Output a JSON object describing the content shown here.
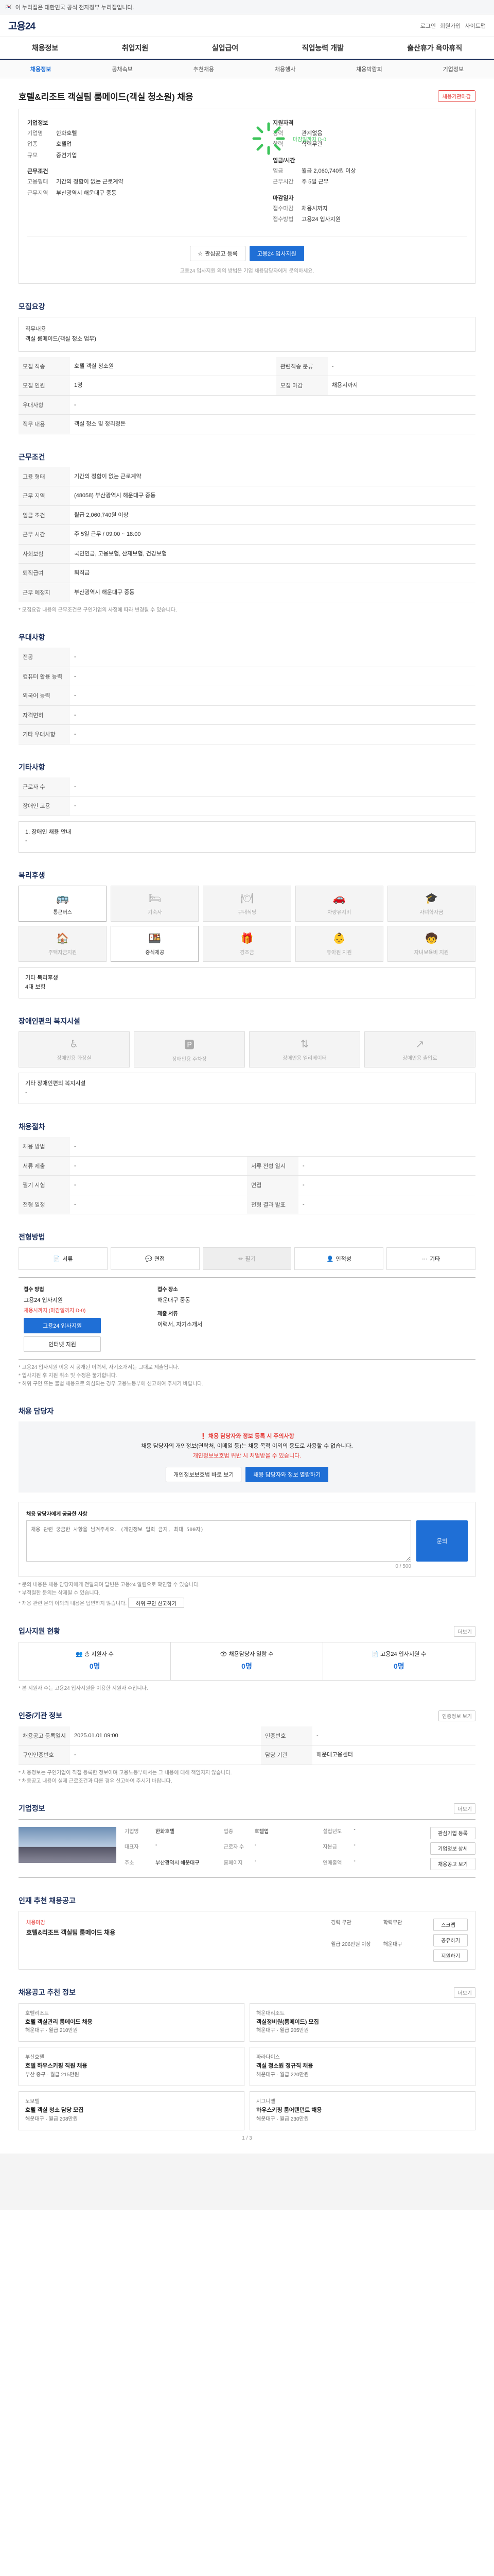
{
  "topbar": {
    "text": "이 누리집은 대한민국 공식 전자정부 누리집입니다."
  },
  "header": {
    "logo": "고용24",
    "links": [
      "로그인",
      "회원가입",
      "사이트맵"
    ]
  },
  "gnb": {
    "items": [
      "채용정보",
      "취업지원",
      "실업급여",
      "직업능력 개발",
      "출산휴가 육아휴직"
    ]
  },
  "subnav": {
    "items": [
      "채용정보",
      "공채속보",
      "추천채용",
      "채용행사",
      "채용박람회",
      "기업정보"
    ],
    "active_index": 0
  },
  "job": {
    "title": "호텔&리조트 객실팀 룸메이드(객실 청소원) 채용",
    "badge": "채용기관마감",
    "company_head": "기업정보",
    "company": [
      {
        "k": "기업명",
        "v": "한화호텔"
      },
      {
        "k": "업종",
        "v": "호텔업"
      },
      {
        "k": "규모",
        "v": "중견기업"
      }
    ],
    "cond_head": "근무조건",
    "cond": [
      {
        "k": "고용형태",
        "v": "기간의 정함이 없는 근로계약"
      },
      {
        "k": "근무지역",
        "v": "부산광역시 해운대구 중동"
      }
    ],
    "career_head": "지원자격",
    "career": [
      {
        "k": "경력",
        "v": "관계없음"
      },
      {
        "k": "학력",
        "v": "학력무관"
      }
    ],
    "wage_head": "임금/시간",
    "wage": [
      {
        "k": "임금",
        "v": "월급 2,060,740원 이상"
      },
      {
        "k": "근무시간",
        "v": "주 5일 근무"
      }
    ],
    "ring_caption": "마감일까지 D-0",
    "deadline_head": "마감일자",
    "deadline": [
      {
        "k": "접수마감",
        "v": "채용시까지"
      },
      {
        "k": "접수방법",
        "v": "고용24 입사지원"
      }
    ],
    "btn_scrap": "관심공고 등록",
    "btn_apply": "고용24 입사지원",
    "note": "고용24 입사지원 외의 방법은 기업 채용담당자에게 문의하세요."
  },
  "recruit": {
    "title": "모집요강",
    "box_h": "직무내용",
    "box_v": "객실 룸메이드(객실 청소 업무)",
    "rows": [
      {
        "k": "모집 직종",
        "v": "호텔 객실 청소원",
        "k2": "관련직종 분류",
        "v2": "-"
      },
      {
        "k": "모집 인원",
        "v": "1명",
        "k2": "모집 마감",
        "v2": "채용시까지"
      },
      {
        "k": "우대사항",
        "v": "-",
        "k2": "",
        "v2": ""
      },
      {
        "k": "직무 내용",
        "v": "객실 청소 및 정리정돈",
        "k2": "",
        "v2": ""
      }
    ]
  },
  "work": {
    "title": "근무조건",
    "rows": [
      {
        "k": "고용 형태",
        "v": "기간의 정함이 없는 근로계약"
      },
      {
        "k": "근무 지역",
        "v": "(48058) 부산광역시 해운대구 중동"
      },
      {
        "k": "임금 조건",
        "v": "월급 2,060,740원 이상"
      },
      {
        "k": "근무 시간",
        "v": "주 5일 근무 / 09:00 ~ 18:00"
      },
      {
        "k": "사회보험",
        "v": "국민연금, 고용보험, 산재보험, 건강보험"
      },
      {
        "k": "퇴직급여",
        "v": "퇴직금"
      },
      {
        "k": "근무 예정지",
        "v": "부산광역시 해운대구 중동"
      }
    ],
    "note": "* 모집요강 내용의 근무조건은 구인기업의 사정에 따라 변경될 수 있습니다."
  },
  "prefer": {
    "title": "우대사항",
    "rows": [
      {
        "k": "전공",
        "v": "-"
      },
      {
        "k": "컴퓨터 활용 능력",
        "v": "-"
      },
      {
        "k": "외국어 능력",
        "v": "-"
      },
      {
        "k": "자격면허",
        "v": "-"
      },
      {
        "k": "기타 우대사항",
        "v": "-"
      }
    ]
  },
  "etc": {
    "title": "기타사항",
    "rows": [
      {
        "k": "근로자 수",
        "v": "-"
      },
      {
        "k": "장애인 고용",
        "v": "-"
      }
    ],
    "box_h": "1. 장애인 채용 안내",
    "box_v": "-"
  },
  "welfare": {
    "title": "복리후생",
    "cards": [
      {
        "label": "통근버스",
        "icon": "bus-icon",
        "glyph": "🚌",
        "on": true
      },
      {
        "label": "기숙사",
        "icon": "bed-icon",
        "glyph": "🛏",
        "on": false
      },
      {
        "label": "구내식당",
        "icon": "meal-icon",
        "glyph": "🍽",
        "on": false
      },
      {
        "label": "차량유지비",
        "icon": "car-icon",
        "glyph": "🚗",
        "on": false
      },
      {
        "label": "자녀학자금",
        "icon": "grad-icon",
        "glyph": "🎓",
        "on": false
      },
      {
        "label": "주택자금지원",
        "icon": "house-icon",
        "glyph": "🏠",
        "on": false
      },
      {
        "label": "중식제공",
        "icon": "lunch-icon",
        "glyph": "🍱",
        "on": true
      },
      {
        "label": "경조금",
        "icon": "gift-icon",
        "glyph": "🎁",
        "on": false
      },
      {
        "label": "유아원 지원",
        "icon": "baby-icon",
        "glyph": "👶",
        "on": false
      },
      {
        "label": "자녀보육비 지원",
        "icon": "kid-icon",
        "glyph": "🧒",
        "on": false
      }
    ],
    "box_h": "기타 복리후생",
    "box_v": "4대 보험"
  },
  "disabled": {
    "title": "장애인편의 복지시설",
    "cards": [
      {
        "label": "장애인용 화장실",
        "icon": "toilet-icon",
        "glyph": "♿"
      },
      {
        "label": "장애인용 주차장",
        "icon": "parking-icon",
        "glyph": "🅿"
      },
      {
        "label": "장애인용 엘리베이터",
        "icon": "elevator-icon",
        "glyph": "⇅"
      },
      {
        "label": "장애인용 출입로",
        "icon": "ramp-icon",
        "glyph": "↗"
      }
    ],
    "box_h": "기타 장애인편의 복지시설",
    "box_v": "-"
  },
  "process": {
    "title": "채용절차",
    "rows": [
      {
        "k": "채용 방법",
        "v": "-",
        "k2": "",
        "v2": ""
      },
      {
        "k": "서류 제출",
        "v": "-",
        "k2": "서류 전형 일시",
        "v2": "-"
      },
      {
        "k": "필기 시험",
        "v": "-",
        "k2": "면접",
        "v2": "-"
      },
      {
        "k": "전형 일정",
        "v": "-",
        "k2": "전형 결과 발표",
        "v2": "-"
      }
    ]
  },
  "contact": {
    "title": "전형방법",
    "tabs": [
      {
        "label": "서류",
        "icon": "doc-icon",
        "glyph": "📄",
        "dim": false
      },
      {
        "label": "면접",
        "icon": "chat-icon",
        "glyph": "💬",
        "dim": false
      },
      {
        "label": "필기",
        "icon": "pen-icon",
        "glyph": "✏",
        "dim": true
      },
      {
        "label": "인적성",
        "icon": "person-icon",
        "glyph": "👤",
        "dim": false
      },
      {
        "label": "기타",
        "icon": "etc-icon",
        "glyph": "⋯",
        "dim": false
      }
    ],
    "h1": "접수 방법",
    "v1": "고용24 입사지원",
    "red1": "채용시까지 (마감일까지 D-0)",
    "btn1": "고용24 입사지원",
    "btn2": "인터넷 지원",
    "h2": "접수 장소",
    "v2": "해운대구 중동",
    "h3": "제출 서류",
    "v3": "이력서, 자기소개서",
    "notes": [
      "* 고용24 입사지원 이용 시 공개된 이력서, 자기소개서는 그대로 제출됩니다.",
      "* 입사지원 후 지원 취소 및 수정은 불가합니다.",
      "* 허위 구인 또는 불법 채용으로 의심되는 경우 고용노동부에 신고하여 주시기 바랍니다."
    ]
  },
  "manager": {
    "title": "채용 담당자",
    "notice_red": "채용 담당자와 정보 등록 시 주의사항",
    "notice_text": "채용 담당자의 개인정보(연락처, 이메일 등)는 채용 목적 이외의 용도로 사용할 수 없습니다.",
    "notice_link": "개인정보보호법 위반 시 처벌받을 수 있습니다.",
    "btn_a": "개인정보보호법 바로 보기",
    "btn_b": "채용 담당자와 정보 열람하기"
  },
  "ask": {
    "title": "채용 담당자에게 궁금한 사항",
    "placeholder": "채용 관련 궁금한 사항을 남겨주세요. (개인정보 입력 금지, 최대 500자)",
    "count": "0 / 500",
    "btn": "문의",
    "notes": [
      "* 문의 내용은 채용 담당자에게 전달되며 답변은 고용24 알림으로 확인할 수 있습니다.",
      "* 부적절한 문의는 삭제될 수 있습니다.",
      "* 채용 관련 문의 이외의 내용은 답변하지 않습니다."
    ],
    "report": "허위 구인 신고하기"
  },
  "status": {
    "title": "입사지원 현황",
    "more": "더보기",
    "cells": [
      {
        "label": "총 지원자 수",
        "value": "0명"
      },
      {
        "label": "채용담당자 열람 수",
        "value": "0명"
      },
      {
        "label": "고용24 입사지원 수",
        "value": "0명"
      }
    ],
    "note": "* 본 지원자 수는 고용24 입사지원을 이용한 지원자 수입니다."
  },
  "reg": {
    "title": "인증/기관 정보",
    "btn": "인증정보 보기",
    "rows": [
      {
        "k": "채용공고 등록일시",
        "v": "2025.01.01 09:00",
        "k2": "인증번호",
        "v2": "-"
      },
      {
        "k": "구인인증번호",
        "v": "-",
        "k2": "담당 기관",
        "v2": "해운대고용센터"
      }
    ],
    "notes": [
      "* 채용정보는 구인기업이 직접 등록한 정보이며 고용노동부에서는 그 내용에 대해 책임지지 않습니다.",
      "* 채용공고 내용이 실제 근로조건과 다른 경우 신고하여 주시기 바랍니다."
    ]
  },
  "company": {
    "title": "기업정보",
    "more": "더보기",
    "rows": [
      {
        "k": "기업명",
        "v": "한화호텔",
        "k2": "업종",
        "v2": "호텔업",
        "k3": "설립년도",
        "v3": "-"
      },
      {
        "k": "대표자",
        "v": "-",
        "k2": "근로자 수",
        "v2": "-",
        "k3": "자본금",
        "v3": "-"
      },
      {
        "k": "주소",
        "v": "부산광역시 해운대구",
        "k2": "홈페이지",
        "v2": "-",
        "k3": "연매출액",
        "v3": "-"
      }
    ],
    "btns": [
      "관심기업 등록",
      "기업정보 상세",
      "채용공고 보기"
    ]
  },
  "other": {
    "title": "인재 추천 채용공고",
    "tag": "채용마감",
    "job_title": "호텔&리조트 객실팀 룸메이드 채용",
    "meta": [
      "경력 무관",
      "학력무관",
      "월급 206만원 이상",
      "해운대구"
    ],
    "btns": [
      "스크랩",
      "공유하기",
      "지원하기"
    ]
  },
  "rec": {
    "title": "채용공고 추천 정보",
    "more": "더보기",
    "tiles": [
      {
        "co": "호텔리조트",
        "t": "호텔 객실관리 룸메이드 채용",
        "m": "해운대구 · 월급 210만원"
      },
      {
        "co": "해운대리조트",
        "t": "객실정비원(룸메이드) 모집",
        "m": "해운대구 · 월급 205만원"
      },
      {
        "co": "부산호텔",
        "t": "호텔 하우스키핑 직원 채용",
        "m": "부산 중구 · 월급 215만원"
      },
      {
        "co": "파라다이스",
        "t": "객실 청소원 정규직 채용",
        "m": "해운대구 · 월급 220만원"
      },
      {
        "co": "노보텔",
        "t": "호텔 객실 청소 담당 모집",
        "m": "해운대구 · 월급 208만원"
      },
      {
        "co": "시그니엘",
        "t": "하우스키핑 룸어텐던트 채용",
        "m": "해운대구 · 월급 230만원"
      }
    ],
    "pager": "1 / 3"
  }
}
